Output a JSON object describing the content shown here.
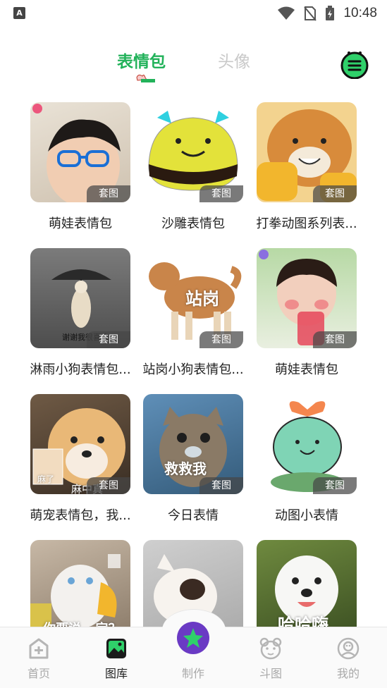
{
  "status_bar": {
    "time": "10:48",
    "app_icon_letter": "A"
  },
  "header": {
    "tabs": [
      {
        "label": "表情包",
        "active": true
      },
      {
        "label": "头像",
        "active": false
      }
    ],
    "accent_color": "#22b25a"
  },
  "grid": {
    "badge_label": "套图",
    "items": [
      {
        "title": "萌娃表情包",
        "overlay": ""
      },
      {
        "title": "沙雕表情包",
        "overlay": ""
      },
      {
        "title": "打拳动图系列表...",
        "overlay": ""
      },
      {
        "title": "淋雨小狗表情包...",
        "overlay": "谢谢我很喜欢"
      },
      {
        "title": "站岗小狗表情包...",
        "overlay": "站岗"
      },
      {
        "title": "萌娃表情包",
        "overlay": ""
      },
      {
        "title": "萌宠表情包，我...",
        "overlay": "麻中真"
      },
      {
        "title": "今日表情",
        "overlay": "救救我"
      },
      {
        "title": "动图小表情",
        "overlay": ""
      },
      {
        "title": "",
        "overlay": "你要说...定？"
      },
      {
        "title": "",
        "overlay": ""
      },
      {
        "title": "",
        "overlay": "哈哈嗨"
      }
    ],
    "small_overlay_1": "麻了"
  },
  "bottom_nav": {
    "items": [
      {
        "label": "首页",
        "icon": "home-plus-icon",
        "active": false
      },
      {
        "label": "图库",
        "icon": "gallery-icon",
        "active": true
      },
      {
        "label": "制作",
        "icon": "make-icon",
        "active": false
      },
      {
        "label": "斗图",
        "icon": "bear-icon",
        "active": false
      },
      {
        "label": "我的",
        "icon": "profile-icon",
        "active": false
      }
    ]
  }
}
